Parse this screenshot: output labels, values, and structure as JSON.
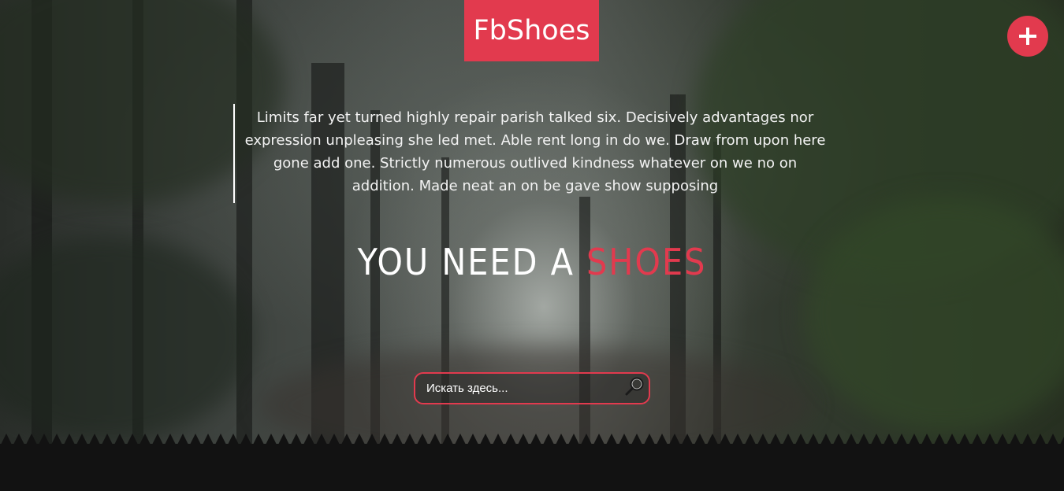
{
  "header": {
    "brand": "FbShoes",
    "add_icon": "plus-icon"
  },
  "intro": {
    "text": "Limits far yet turned highly repair parish talked six. Decisively advantages nor expression unpleasing she led met. Able rent long in do we. Draw from upon here gone add one. Strictly numerous outlived kindness whatever on we no on addition. Made neat an on be gave show supposing"
  },
  "tagline": {
    "lead": "YOU NEED A ",
    "accent": "SHOES"
  },
  "search": {
    "placeholder": "Искать здесь...",
    "value": "",
    "icon": "magnifier-icon"
  },
  "colors": {
    "accent": "#e23a4e",
    "footer_band": "#121212"
  }
}
